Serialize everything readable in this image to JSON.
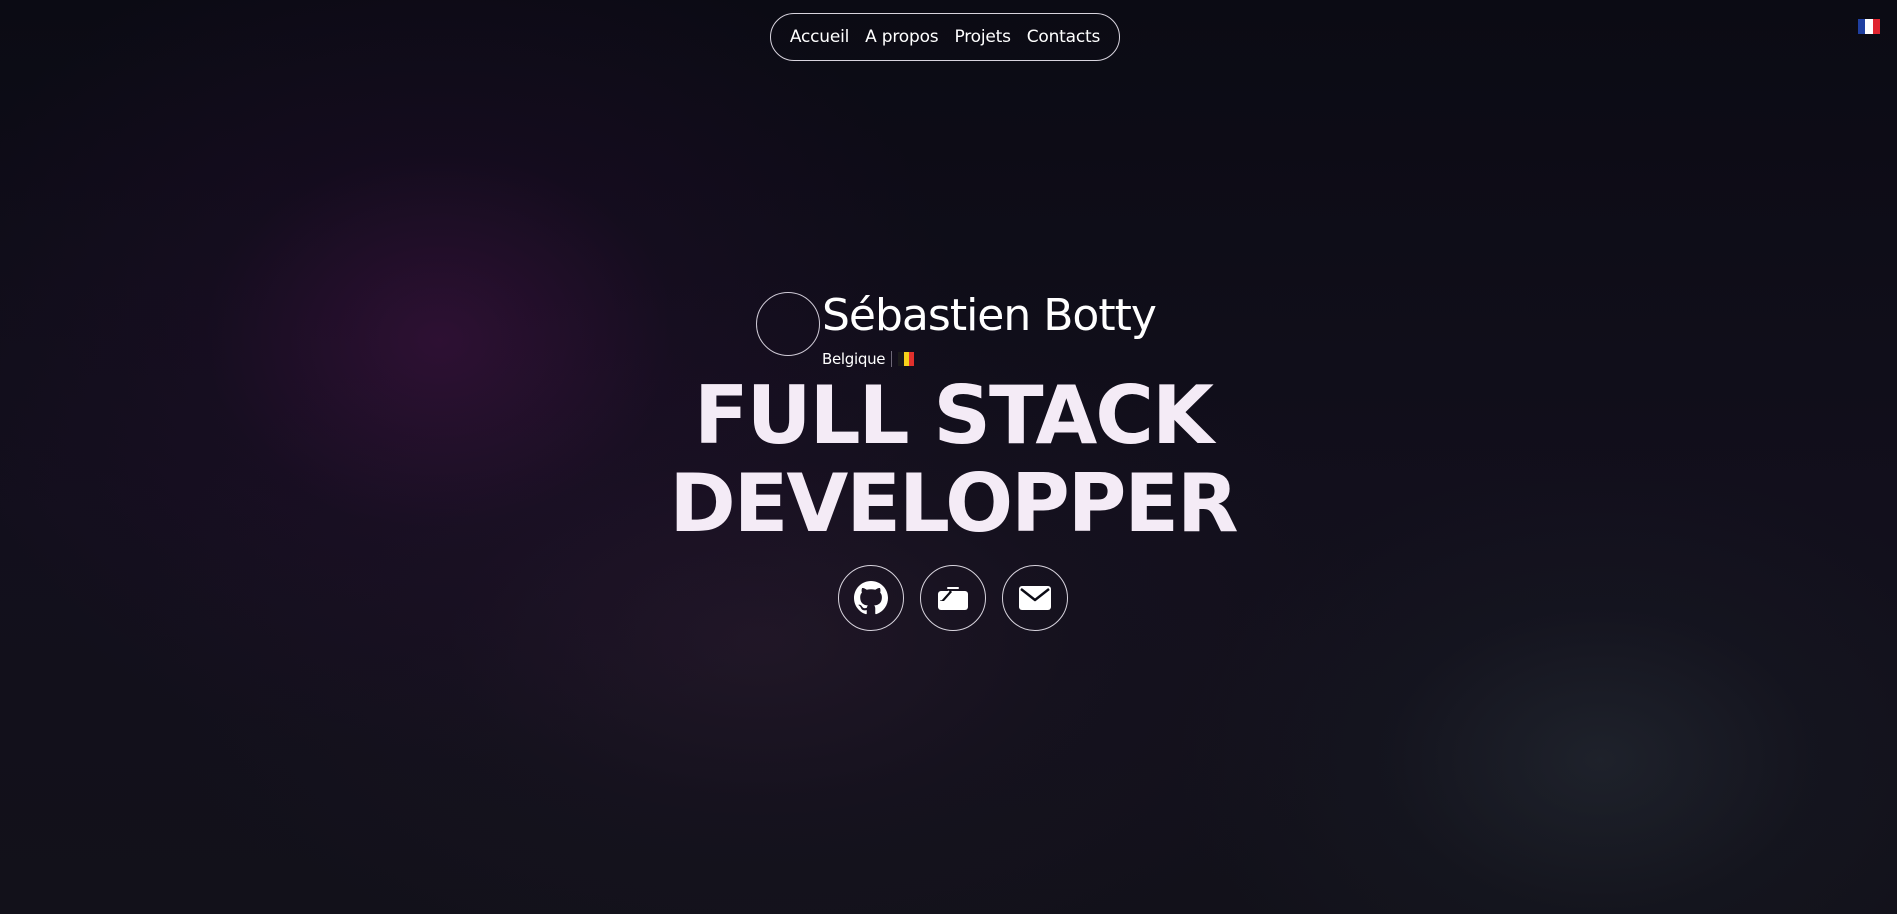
{
  "nav": {
    "items": [
      {
        "label": "Accueil"
      },
      {
        "label": "A propos"
      },
      {
        "label": "Projets"
      },
      {
        "label": "Contacts"
      }
    ]
  },
  "language": {
    "icon": "france-flag-icon",
    "colors": [
      "#1f3fa0",
      "#ffffff",
      "#e0242f"
    ]
  },
  "profile": {
    "name": "Sébastien Botty",
    "country": "Belgique",
    "country_flag_icon": "belgium-flag-icon",
    "country_flag_colors": [
      "#1b1b1b",
      "#f6d21a",
      "#e0302c"
    ]
  },
  "headline": {
    "line1": "FULL STACK",
    "line2": "DEVELOPPER"
  },
  "socials": [
    {
      "icon": "github-icon"
    },
    {
      "icon": "portfolio-card-icon"
    },
    {
      "icon": "mail-icon"
    }
  ],
  "colors": {
    "background": "#0b0b14",
    "headline": "#f4ebf6",
    "outline": "#d8d4de"
  }
}
